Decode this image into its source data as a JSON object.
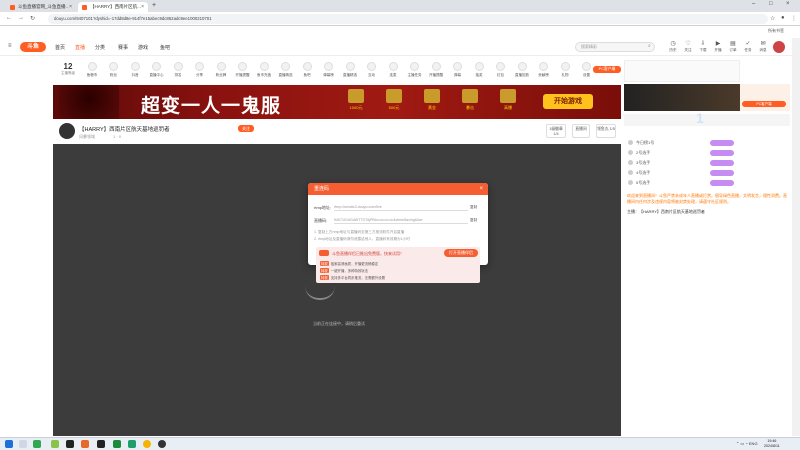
{
  "browser": {
    "tabs": [
      {
        "label": "斗鱼直播官网_斗鱼直播..",
        "active": false
      },
      {
        "label": "【HARRY】西南片区航...",
        "active": true
      }
    ],
    "url": "douyu.com/9407101?dyshid=-17dd8d8e-914f7e15abec9dc862adc9ee1000210701",
    "nav_icons": [
      "back-icon",
      "forward-icon",
      "reload-icon"
    ],
    "bookmarks_label": "所有书签"
  },
  "site": {
    "logo_text": "斗鱼",
    "nav": [
      "首页",
      "直播",
      "分类",
      "赛事",
      "游戏",
      "鱼吧"
    ],
    "active_nav": "直播",
    "search_placeholder": "搜索精彩",
    "header_icons": [
      {
        "label": "历史",
        "icon": "history-icon"
      },
      {
        "label": "关注",
        "icon": "follow-icon"
      },
      {
        "label": "下载",
        "icon": "download-icon"
      },
      {
        "label": "开播",
        "icon": "broadcast-icon"
      },
      {
        "label": "订单",
        "icon": "order-icon"
      },
      {
        "label": "任务",
        "icon": "task-icon"
      },
      {
        "label": "消息",
        "icon": "message-icon"
      }
    ]
  },
  "gift_row": {
    "level": "12",
    "level_label": "主播等级",
    "items": [
      "鱼粮币",
      "粉丝",
      "抖音",
      "直播中心",
      "排名",
      "分享",
      "粉丝牌",
      "开播提醒",
      "鱼币充值",
      "直播精选",
      "鱼吧",
      "弹幕榜",
      "直播精选",
      "互动",
      "连麦",
      "主播任务",
      "开播提醒",
      "弹幕",
      "抽奖",
      "红包",
      "直播回放",
      "贡献榜",
      "礼物",
      "设置"
    ],
    "pc_label": "PC客户端"
  },
  "banner": {
    "headline": "超变一人一鬼服",
    "prizes": [
      "1000元",
      "500元",
      "黄金",
      "暴击",
      "高爆"
    ],
    "play_button": "开始游戏"
  },
  "stream": {
    "title": "【HARRY】西南片区航天基地巡罚者",
    "follow": "关注",
    "streamer": "风暴领域",
    "meta": "1 · 0",
    "boxes": [
      "1级徽章\n1/4",
      "直播间",
      "领鱼丸\n1/5"
    ]
  },
  "video": {
    "status_text": "当前正在连接中，请稍后重试"
  },
  "sidebar": {
    "ad_label": "PC客户端",
    "rank_items": [
      "今日榜1号",
      "2号选手",
      "3号选手",
      "4号选手",
      "5号选手"
    ],
    "announce": "主播：【HARRY】西南片区航天基地巡罚者",
    "chat_text": "欢迎来到直播间！斗鱼严禁未成年人直播或打赏。倡导绿色直播，文明发言，理性消费。直播间内任何涉及违规内容将被封禁处理，请遵守社区规则。"
  },
  "modal": {
    "title": "重连码",
    "close_icon": "close-icon",
    "rows": [
      {
        "label": "rtmp地址:",
        "value": "rtmp://sendtc3.douyu.com/live",
        "copy": "复制"
      },
      {
        "label": "直播码:",
        "value": "9407101rlGdWTTSTdjPBt••••••••••••••&drmsSaving&live",
        "copy": "复制"
      }
    ],
    "tips": [
      "1. 复制上方rtmp地址与直播码至第三方推流软件开启直播",
      "2. rtmp地址及直播码请勿泄露给他人，直播码有效期为1小时"
    ],
    "promo_title": "斗鱼直播伴侣已推出免费版，快来试用！",
    "promo_button": "打开直播伴侣",
    "promo_lines": [
      {
        "tag": "特权",
        "text": "独家高清画质，开播更流畅稳定"
      },
      {
        "tag": "特权",
        "text": "一键开播，多种特效玩法"
      },
      {
        "tag": "特权",
        "text": "支持多平台同步推流，无需额外设置"
      }
    ]
  },
  "taskbar": {
    "apps": [
      "windows-icon",
      "search-icon",
      "task-view-icon",
      "file-explorer-icon",
      "edge-icon",
      "store-icon",
      "mail-icon",
      "chrome-icon",
      "app-icon"
    ],
    "lang": "ENG",
    "time": "19:46",
    "date": "2024/8/11"
  }
}
